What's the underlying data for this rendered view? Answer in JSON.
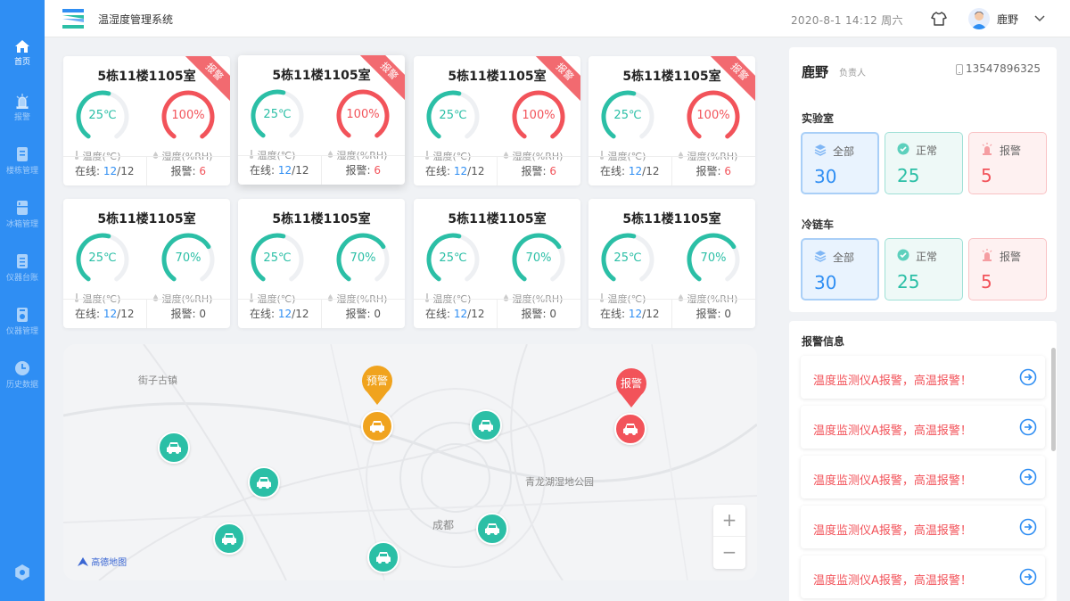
{
  "header": {
    "title": "温湿度管理系统",
    "datetime": "2020-8-1  14:12  周六",
    "user": "鹿野"
  },
  "nav": [
    {
      "label": "首页",
      "icon": "home-icon",
      "active": true
    },
    {
      "label": "报警",
      "icon": "alarm-icon",
      "active": false
    },
    {
      "label": "楼栋管理",
      "icon": "building-icon",
      "active": false
    },
    {
      "label": "冰箱管理",
      "icon": "fridge-icon",
      "active": false
    },
    {
      "label": "仪器台账",
      "icon": "ledger-icon",
      "active": false
    },
    {
      "label": "仪器管理",
      "icon": "device-icon",
      "active": false
    },
    {
      "label": "历史数据",
      "icon": "clock-icon",
      "active": false
    }
  ],
  "cards": [
    {
      "title": "5栋11楼1105室",
      "ribbon": "报警",
      "temp": "25℃",
      "temp_level": 0.55,
      "humidity": "100%",
      "hum_level": 1.0,
      "temp_label": "温度(℃)",
      "hum_label": "湿度(%RH)",
      "online_label": "在线: ",
      "online": "12",
      "online_total": "/12",
      "alarm_label": "报警: ",
      "alarm": "6"
    },
    {
      "title": "5栋11楼1105室",
      "ribbon": "报警",
      "temp": "25℃",
      "temp_level": 0.55,
      "humidity": "100%",
      "hum_level": 1.0,
      "temp_label": "温度(℃)",
      "hum_label": "湿度(%RH)",
      "online_label": "在线: ",
      "online": "12",
      "online_total": "/12",
      "alarm_label": "报警: ",
      "alarm": "6"
    },
    {
      "title": "5栋11楼1105室",
      "ribbon": "报警",
      "temp": "25℃",
      "temp_level": 0.55,
      "humidity": "100%",
      "hum_level": 1.0,
      "temp_label": "温度(℃)",
      "hum_label": "湿度(%RH)",
      "online_label": "在线: ",
      "online": "12",
      "online_total": "/12",
      "alarm_label": "报警: ",
      "alarm": "6"
    },
    {
      "title": "5栋11楼1105室",
      "ribbon": "报警",
      "temp": "25℃",
      "temp_level": 0.55,
      "humidity": "100%",
      "hum_level": 1.0,
      "temp_label": "温度(℃)",
      "hum_label": "湿度(%RH)",
      "online_label": "在线: ",
      "online": "12",
      "online_total": "/12",
      "alarm_label": "报警: ",
      "alarm": "6"
    },
    {
      "title": "5栋11楼1105室",
      "ribbon": "",
      "temp": "25℃",
      "temp_level": 0.55,
      "humidity": "70%",
      "hum_level": 0.7,
      "temp_label": "温度(℃)",
      "hum_label": "湿度(%RH)",
      "online_label": "在线: ",
      "online": "12",
      "online_total": "/12",
      "alarm_label": "报警: ",
      "alarm": "0"
    },
    {
      "title": "5栋11楼1105室",
      "ribbon": "",
      "temp": "25℃",
      "temp_level": 0.55,
      "humidity": "70%",
      "hum_level": 0.7,
      "temp_label": "温度(℃)",
      "hum_label": "湿度(%RH)",
      "online_label": "在线: ",
      "online": "12",
      "online_total": "/12",
      "alarm_label": "报警: ",
      "alarm": "0"
    },
    {
      "title": "5栋11楼1105室",
      "ribbon": "",
      "temp": "25℃",
      "temp_level": 0.55,
      "humidity": "70%",
      "hum_level": 0.7,
      "temp_label": "温度(℃)",
      "hum_label": "湿度(%RH)",
      "online_label": "在线: ",
      "online": "12",
      "online_total": "/12",
      "alarm_label": "报警: ",
      "alarm": "0"
    },
    {
      "title": "5栋11楼1105室",
      "ribbon": "",
      "temp": "25℃",
      "temp_level": 0.55,
      "humidity": "70%",
      "hum_level": 0.7,
      "temp_label": "温度(℃)",
      "hum_label": "湿度(%RH)",
      "online_label": "在线: ",
      "online": "12",
      "online_total": "/12",
      "alarm_label": "报警: ",
      "alarm": "0"
    }
  ],
  "map": {
    "places": [
      "街子古镇",
      "青龙湖湿地公园",
      "成都"
    ],
    "pins": [
      {
        "label": "预警",
        "color": "#f0a31e"
      },
      {
        "label": "报警",
        "color": "#f2535a"
      }
    ],
    "zoom_in": "+",
    "zoom_out": "−",
    "provider": "高德地图"
  },
  "manager": {
    "name": "鹿野",
    "role": "负责人",
    "phone": "13547896325"
  },
  "lab": {
    "title": "实验室",
    "all_label": "全部",
    "all": "30",
    "ok_label": "正常",
    "ok": "25",
    "alarm_label": "报警",
    "alarm": "5"
  },
  "coldchain": {
    "title": "冷链车",
    "all_label": "全部",
    "all": "30",
    "ok_label": "正常",
    "ok": "25",
    "alarm_label": "报警",
    "alarm": "5"
  },
  "alerts": {
    "title": "报警信息",
    "items": [
      "温度监测仪A报警，高温报警！",
      "温度监测仪A报警，高温报警！",
      "温度监测仪A报警，高温报警！",
      "温度监测仪A报警，高温报警！",
      "温度监测仪A报警，高温报警！"
    ]
  },
  "colors": {
    "primary": "#2f8ef3",
    "teal": "#2bbfa6",
    "alarm": "#f2535a",
    "warn": "#f0a31e"
  }
}
